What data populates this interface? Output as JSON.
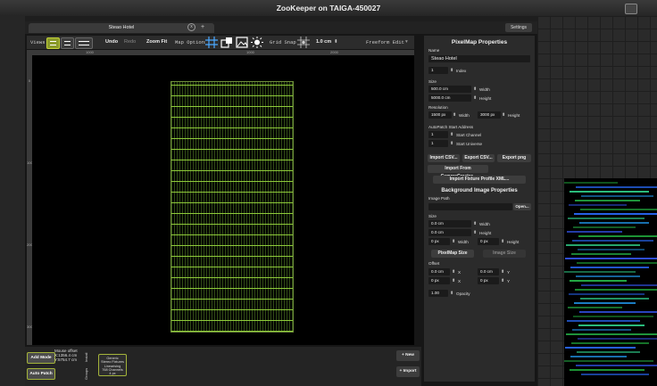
{
  "window": {
    "title": "ZooKeeper on TAIGA-450027"
  },
  "tab": {
    "name": "Steao Hotel",
    "close": "x",
    "add": "+"
  },
  "settings_label": "Settings",
  "toolbar": {
    "views_label": "Views",
    "undo_label": "Undo",
    "redo_label": "Redo",
    "zoom_fit_label": "Zoom Fit",
    "map_options_label": "Map Options",
    "grid_snap_label": "Grid Snap",
    "grid_value": "1.0 cm",
    "freeform_label": "Freeform Edit"
  },
  "ruler": {
    "top": [
      "1000",
      "1000",
      "2000"
    ],
    "left": [
      "0",
      "1000",
      "2000",
      "3000"
    ]
  },
  "panel": {
    "title": "PixelMap Properties",
    "name_label": "Name",
    "name_value": "Steao Hotel",
    "index_value": "1",
    "index_label": "Index",
    "size_label": "Size",
    "width_value": "500.0 cm",
    "width_label": "Width",
    "height_value": "5000.0 cm",
    "height_label": "Height",
    "resolution_label": "Resolution",
    "res_w_value": "1500 px",
    "res_w_label": "Width",
    "res_h_value": "3000 px",
    "res_h_label": "Height",
    "autopatch_label": "AutoPatch Start Address",
    "start_channel_value": "1",
    "start_channel_label": "Start Channel",
    "start_universe_value": "1",
    "start_universe_label": "Start Universe",
    "import_csv": "Import CSV...",
    "export_csv": "Export CSV...",
    "export_png": "Export png",
    "import_camera": "Import From CameraCreator..",
    "import_profile": "Import Fixture Profile XML...",
    "bg_title": "Background Image Properties",
    "image_path_label": "Image Path",
    "open_label": "Open...",
    "bg_size_label": "Size",
    "bg_w_value": "0.0 cm",
    "bg_w_label": "Width",
    "bg_h_value": "0.0 cm",
    "bg_h_label": "Height",
    "bg_pxw_value": "0 px",
    "bg_pxw_label": "Width",
    "bg_pxh_value": "0 px",
    "bg_pxh_label": "Height",
    "pixelmap_size_btn": "PixelMap Size",
    "image_size_btn": "Image Size",
    "offset_label": "Offset",
    "off_cm_x_value": "0.0 cm",
    "off_cm_x_label": "X",
    "off_cm_y_value": "0.0 cm",
    "off_cm_y_label": "Y",
    "off_px_x_value": "0 px",
    "off_px_x_label": "X",
    "off_px_y_value": "0 px",
    "off_px_y_label": "Y",
    "opacity_value": "1.00",
    "opacity_label": "Opacity"
  },
  "bottom": {
    "add_mode": "Add Mode",
    "auto_patch": "Auto Patch",
    "mouse_offset_label": "Mouse offset",
    "mouse_x": "X:1356.4 cm",
    "mouse_y": "Y:5754.7 cm",
    "tab_install": "Install",
    "tab_groups": "Groups",
    "fixture_line1": "Generic",
    "fixture_line2": "Stereo Fixtures",
    "fixture_line3": "Linearising",
    "fixture_line4": "768 Channels",
    "fixture_line5": "4 px",
    "new_label": "+ New",
    "import_label": "+ Import"
  }
}
